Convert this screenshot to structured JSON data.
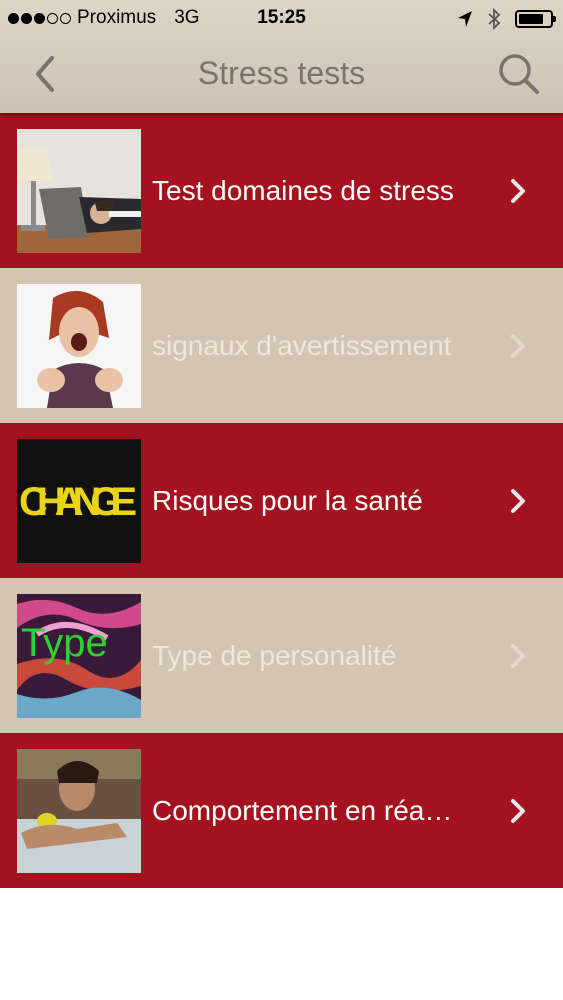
{
  "status_bar": {
    "carrier": "Proximus",
    "network": "3G",
    "time": "15:25",
    "signal_bars_filled": 3,
    "signal_bars_total": 5
  },
  "nav": {
    "title": "Stress tests",
    "back_icon": "chevron-left-icon",
    "search_icon": "search-icon"
  },
  "items": [
    {
      "label": "Test domaines de stress",
      "style": "red",
      "image": "office-worker-asleep-on-laptop"
    },
    {
      "label": "signaux d'avertissement",
      "style": "beige",
      "image": "screaming-woman"
    },
    {
      "label": "Risques pour la santé",
      "style": "red",
      "image": "change-sign",
      "image_text": "CHANGE"
    },
    {
      "label": "Type de personalité",
      "style": "beige",
      "image": "colorful-type-art",
      "image_text": "Type"
    },
    {
      "label": "Comportement en réa…",
      "style": "red",
      "image": "woman-in-bathtub"
    }
  ],
  "colors": {
    "row_red": "#a3121e",
    "row_beige": "#d3c5b2",
    "header_bg": "#d6ccbd",
    "title_text": "#7a736c"
  }
}
